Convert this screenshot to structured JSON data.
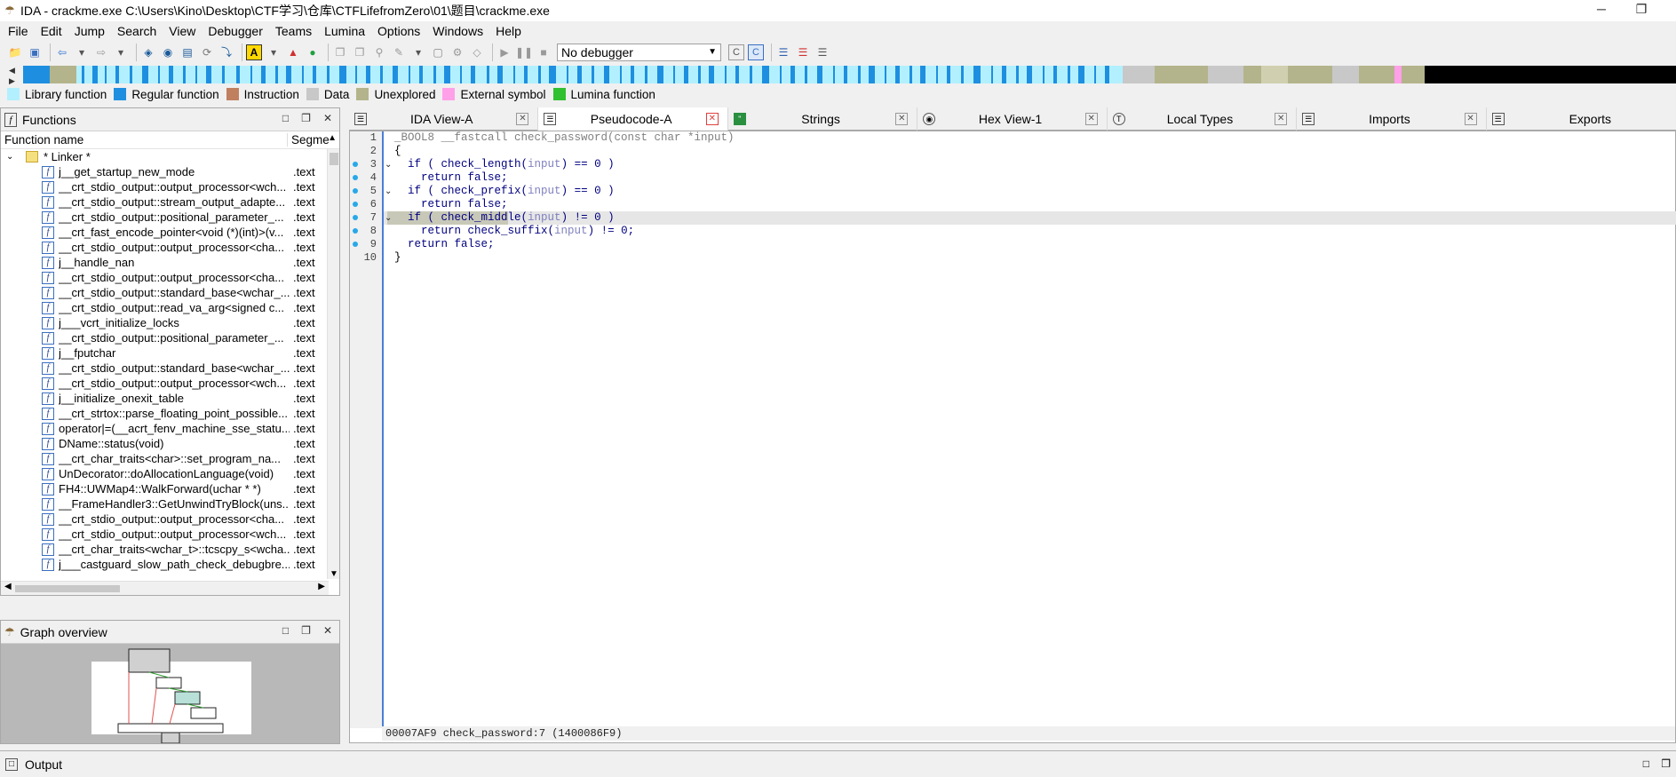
{
  "window": {
    "title": "IDA - crackme.exe C:\\Users\\Kino\\Desktop\\CTF学习\\仓库\\CTFLifefromZero\\01\\题目\\crackme.exe",
    "minimize": "─",
    "restore": "❐"
  },
  "menu": [
    "File",
    "Edit",
    "Jump",
    "Search",
    "View",
    "Debugger",
    "Teams",
    "Lumina",
    "Options",
    "Windows",
    "Help"
  ],
  "toolbar": {
    "debugger_select": "No debugger"
  },
  "legend": [
    {
      "label": "Library function",
      "color": "#b3f0ff"
    },
    {
      "label": "Regular function",
      "color": "#1e8fe0"
    },
    {
      "label": "Instruction",
      "color": "#c08060"
    },
    {
      "label": "Data",
      "color": "#c8c8c8"
    },
    {
      "label": "Unexplored",
      "color": "#b4b48c"
    },
    {
      "label": "External symbol",
      "color": "#ffa0e8"
    },
    {
      "label": "Lumina function",
      "color": "#30c030"
    }
  ],
  "functions_pane": {
    "title": "Functions",
    "col_name": "Function name",
    "col_segment": "Segme",
    "group": "* Linker *",
    "rows": [
      {
        "name": "j__get_startup_new_mode",
        "seg": ".text"
      },
      {
        "name": "__crt_stdio_output::output_processor<wch...",
        "seg": ".text"
      },
      {
        "name": "__crt_stdio_output::stream_output_adapte...",
        "seg": ".text"
      },
      {
        "name": "__crt_stdio_output::positional_parameter_...",
        "seg": ".text"
      },
      {
        "name": "__crt_fast_encode_pointer<void (*)(int)>(v...",
        "seg": ".text"
      },
      {
        "name": "__crt_stdio_output::output_processor<cha...",
        "seg": ".text"
      },
      {
        "name": "j__handle_nan",
        "seg": ".text"
      },
      {
        "name": "__crt_stdio_output::output_processor<cha...",
        "seg": ".text"
      },
      {
        "name": "__crt_stdio_output::standard_base<wchar_...",
        "seg": ".text"
      },
      {
        "name": "__crt_stdio_output::read_va_arg<signed c...",
        "seg": ".text"
      },
      {
        "name": "j___vcrt_initialize_locks",
        "seg": ".text"
      },
      {
        "name": "__crt_stdio_output::positional_parameter_...",
        "seg": ".text"
      },
      {
        "name": "j__fputchar",
        "seg": ".text"
      },
      {
        "name": "__crt_stdio_output::standard_base<wchar_...",
        "seg": ".text"
      },
      {
        "name": "__crt_stdio_output::output_processor<wch...",
        "seg": ".text"
      },
      {
        "name": "j__initialize_onexit_table",
        "seg": ".text"
      },
      {
        "name": "__crt_strtox::parse_floating_point_possible...",
        "seg": ".text"
      },
      {
        "name": "operator|=(__acrt_fenv_machine_sse_statu...",
        "seg": ".text"
      },
      {
        "name": "DName::status(void)",
        "seg": ".text"
      },
      {
        "name": "__crt_char_traits<char>::set_program_na...",
        "seg": ".text"
      },
      {
        "name": "UnDecorator::doAllocationLanguage(void)",
        "seg": ".text"
      },
      {
        "name": "FH4::UWMap4::WalkForward(uchar * *)",
        "seg": ".text"
      },
      {
        "name": "__FrameHandler3::GetUnwindTryBlock(uns...",
        "seg": ".text"
      },
      {
        "name": "__crt_stdio_output::output_processor<cha...",
        "seg": ".text"
      },
      {
        "name": "__crt_stdio_output::output_processor<wch...",
        "seg": ".text"
      },
      {
        "name": "__crt_char_traits<wchar_t>::tcscpy_s<wcha...",
        "seg": ".text"
      },
      {
        "name": "j___castguard_slow_path_check_debugbre...",
        "seg": ".text"
      }
    ]
  },
  "graph_pane": {
    "title": "Graph overview"
  },
  "tabs": [
    {
      "label": "IDA View-A",
      "active": false
    },
    {
      "label": "Pseudocode-A",
      "active": true
    },
    {
      "label": "Strings",
      "active": false
    },
    {
      "label": "Hex View-1",
      "active": false
    },
    {
      "label": "Local Types",
      "active": false
    },
    {
      "label": "Imports",
      "active": false
    },
    {
      "label": "Exports",
      "active": false
    }
  ],
  "code": {
    "line_numbers": [
      "1",
      "2",
      "3",
      "4",
      "5",
      "6",
      "7",
      "8",
      "9",
      "10"
    ],
    "l1": "_BOOL8 __fastcall check_password(const char *input)",
    "l2": "{",
    "l3": [
      "  if ( ",
      "check_length",
      "(",
      "input",
      ") == 0 )"
    ],
    "l4": "    return false;",
    "l5": [
      "  if ( ",
      "check_prefix",
      "(",
      "input",
      ") == 0 )"
    ],
    "l6": "    return false;",
    "l7": [
      "  if ( ",
      "check_middle",
      "(",
      "input",
      ") != 0 )"
    ],
    "l8": [
      "    return ",
      "check_suffix",
      "(",
      "input",
      ") != 0;"
    ],
    "l9": "  return false;",
    "l10": "}",
    "status": "00007AF9 check_password:7 (1400086F9)"
  },
  "output_pane": {
    "title": "Output"
  }
}
